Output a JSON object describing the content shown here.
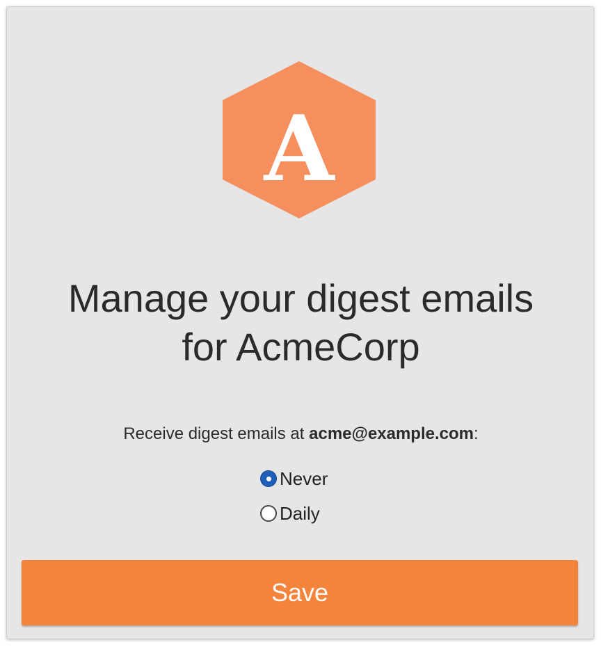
{
  "brand": {
    "logo_letter": "A",
    "logo_color": "#f58f5d",
    "logo_letter_color": "#ffffff",
    "icon": "hexagon-logo"
  },
  "heading": {
    "line1": "Manage your digest emails",
    "line2": "for AcmeCorp"
  },
  "prompt": {
    "prefix": "Receive digest emails at",
    "email": "acme@example.com",
    "suffix": ":"
  },
  "frequency": {
    "options": [
      {
        "label": "Never",
        "selected": true
      },
      {
        "label": "Daily",
        "selected": false
      }
    ]
  },
  "actions": {
    "save_label": "Save",
    "save_color": "#f4843c"
  }
}
